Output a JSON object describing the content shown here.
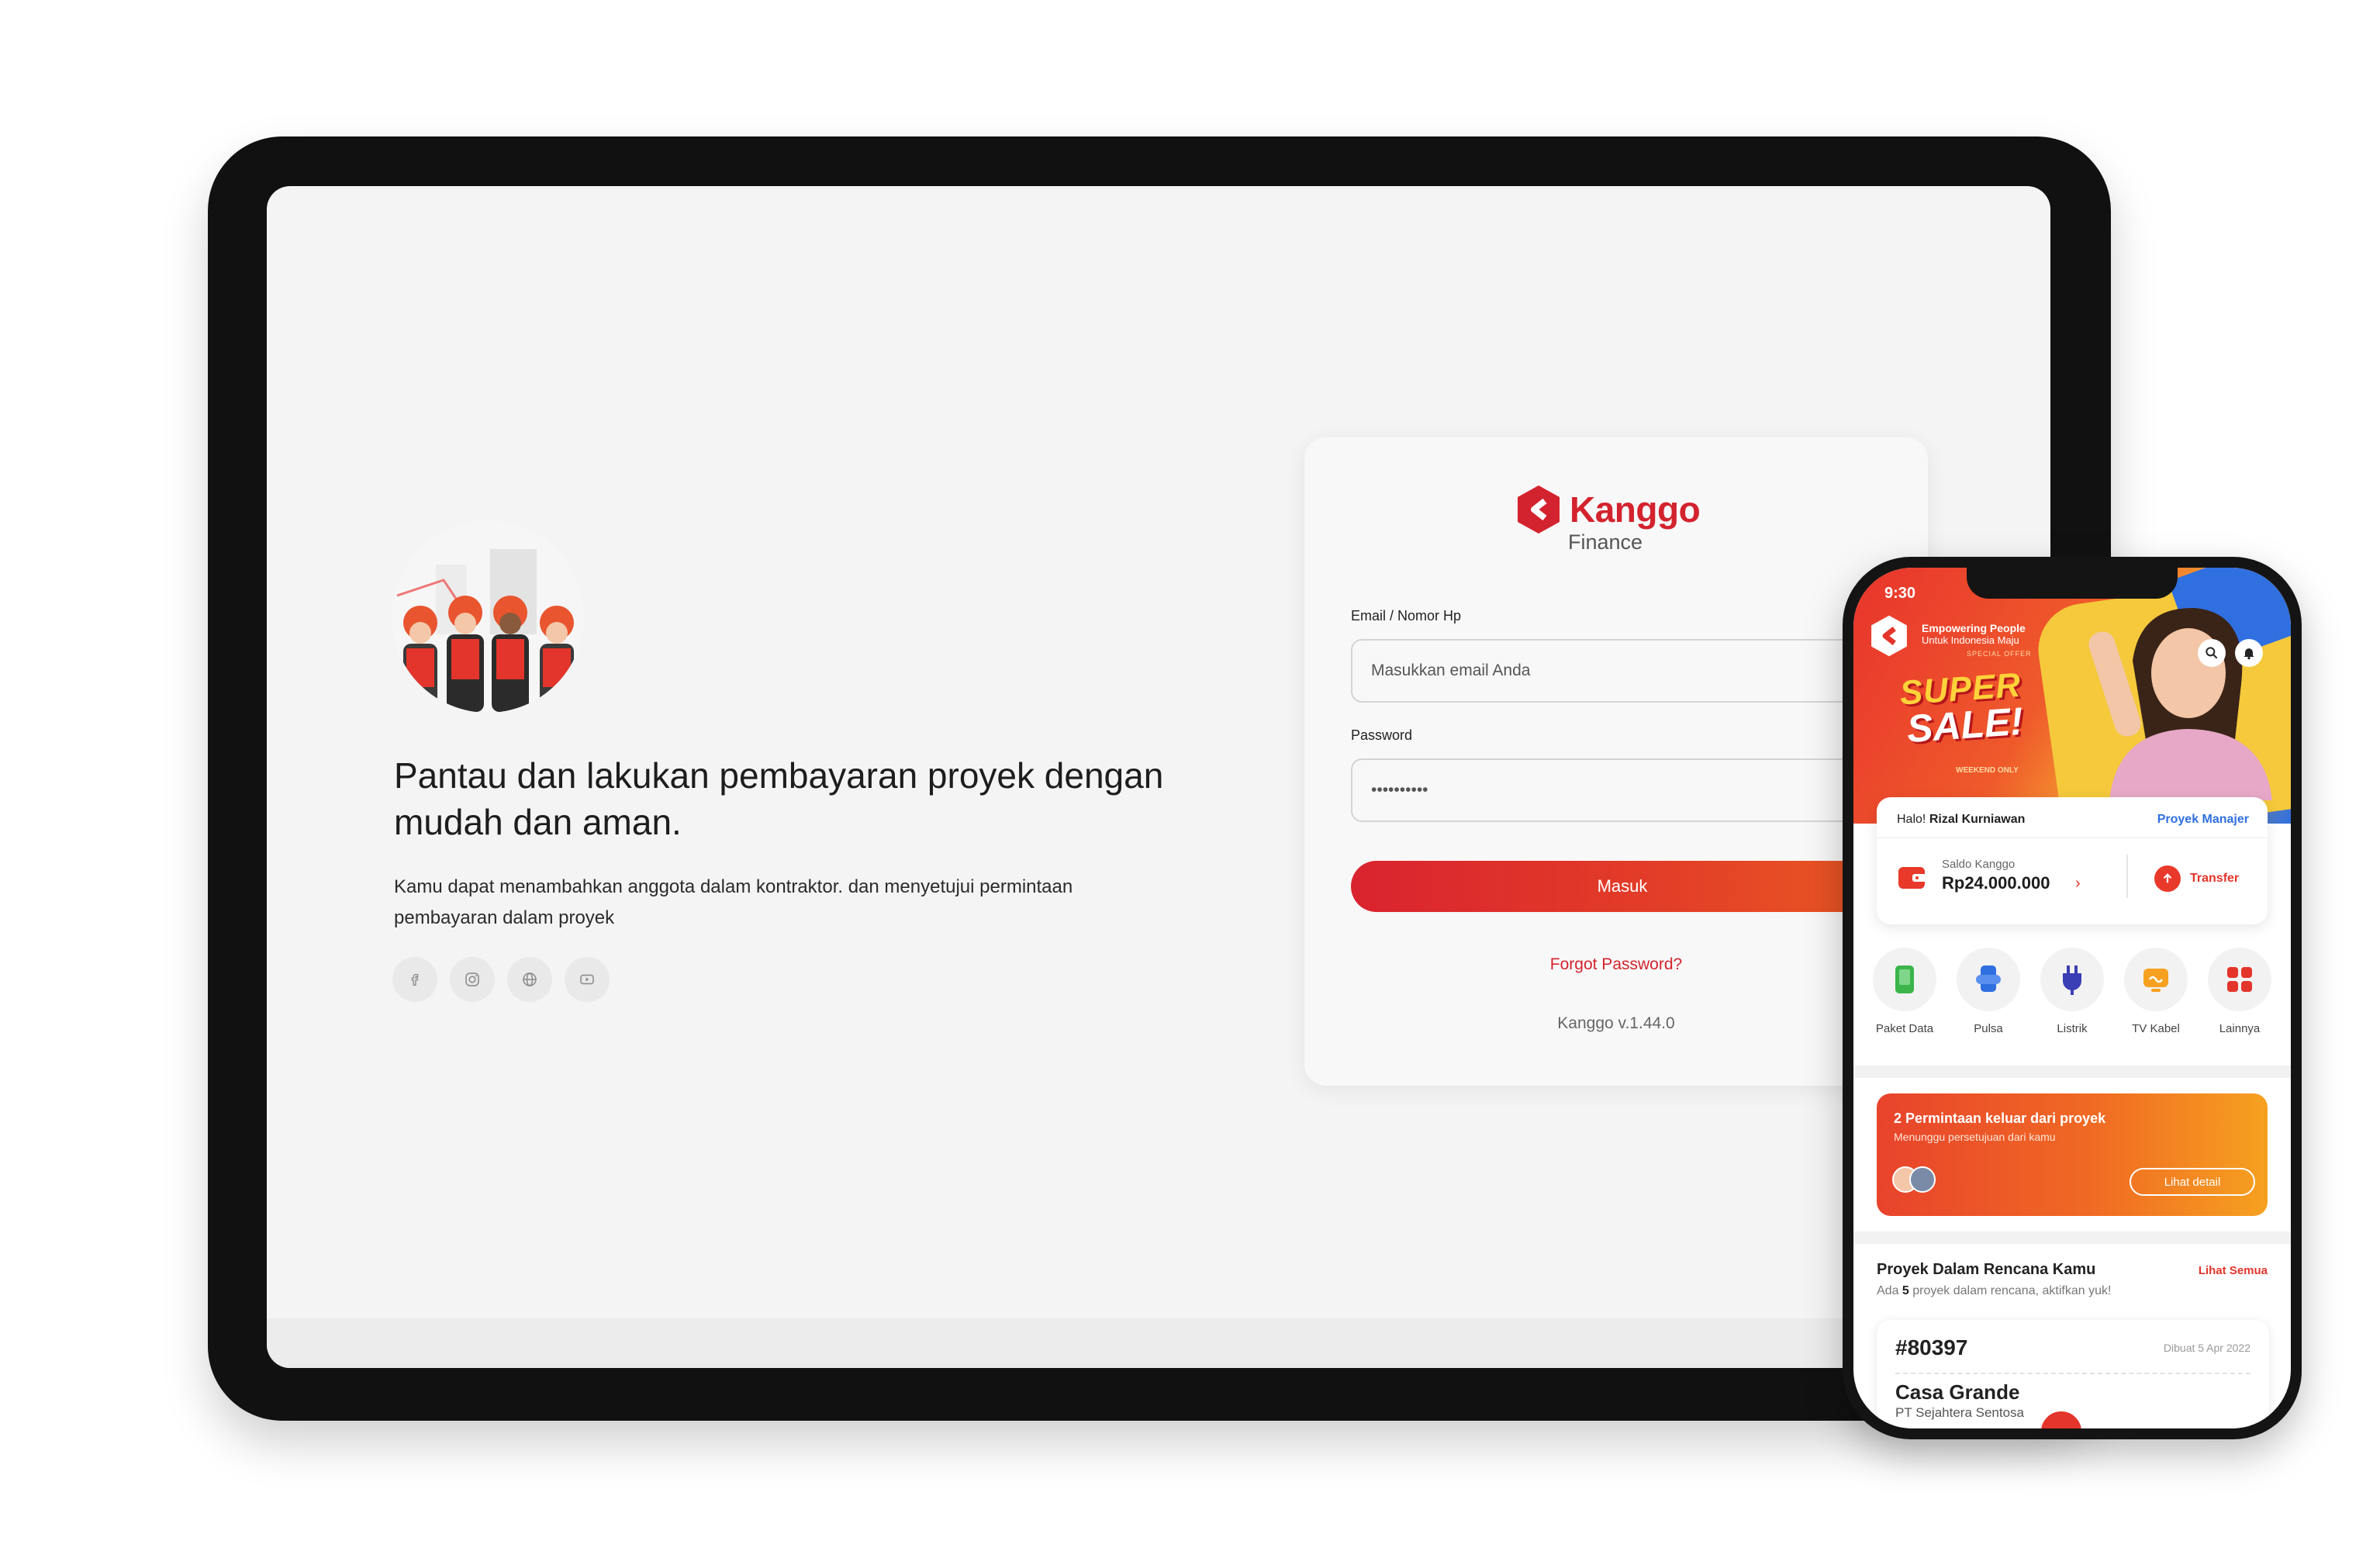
{
  "tablet": {
    "tagline": "Pantau dan lakukan pembayaran proyek dengan mudah dan aman.",
    "description": "Kamu dapat menambahkan anggota dalam kontraktor. dan menyetujui permintaan pembayaran dalam proyek",
    "socials": [
      "facebook-icon",
      "instagram-icon",
      "globe-icon",
      "youtube-icon"
    ],
    "login": {
      "brand_name": "Kanggo",
      "brand_sub": "Finance",
      "email_label": "Email / Nomor Hp",
      "email_placeholder": "Masukkan email Anda",
      "password_label": "Password",
      "password_value": "••••••••••",
      "submit_label": "Masuk",
      "forgot_label": "Forgot Password?",
      "version": "Kanggo v.1.44.0"
    },
    "colors": {
      "brand_red": "#d3232e",
      "button_end": "#ea5a23"
    }
  },
  "phone": {
    "status_time": "9:30",
    "banner": {
      "headline": "Empowering People",
      "subline": "Untuk Indonesia Maju",
      "offer": "SPECIAL OFFER",
      "sale_line1": "SUPER",
      "sale_line2": "SALE!",
      "weekend": "WEEKEND ONLY"
    },
    "balance": {
      "greeting_prefix": "Halo!",
      "user_name": "Rizal Kurniawan",
      "role": "Proyek Manajer",
      "saldo_label": "Saldo Kanggo",
      "saldo_value": "Rp24.000.000",
      "transfer_label": "Transfer"
    },
    "services": [
      {
        "label": "Paket Data",
        "icon": "phone-data-icon"
      },
      {
        "label": "Pulsa",
        "icon": "pulsa-icon"
      },
      {
        "label": "Listrik",
        "icon": "plug-icon"
      },
      {
        "label": "TV Kabel",
        "icon": "tv-icon"
      },
      {
        "label": "Lainnya",
        "icon": "grid-icon"
      }
    ],
    "request": {
      "title": "2 Permintaan keluar dari proyek",
      "subtitle": "Menunggu persetujuan dari kamu",
      "button": "Lihat detail"
    },
    "projects": {
      "title": "Proyek Dalam Rencana Kamu",
      "see_all": "Lihat Semua",
      "subtitle_pre": "Ada",
      "subtitle_count": "5",
      "subtitle_post": "proyek dalam rencana, aktifkan yuk!",
      "card": {
        "id": "#80397",
        "date": "Dibuat 5 Apr 2022",
        "name": "Casa Grande",
        "company": "PT Sejahtera Sentosa"
      }
    }
  }
}
